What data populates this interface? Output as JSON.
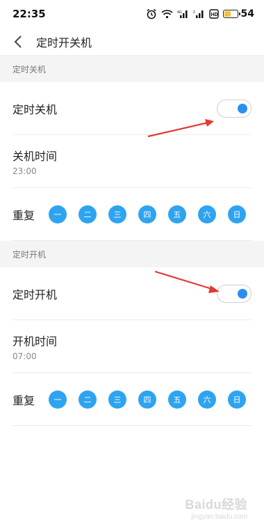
{
  "status_bar": {
    "time": "22:35",
    "battery_percent": "54",
    "battery_level": 0.54
  },
  "header": {
    "title": "定时开关机"
  },
  "shutdown": {
    "section_title": "定时关机",
    "toggle_label": "定时关机",
    "toggle_on": true,
    "time_label": "关机时间",
    "time_value": "23:00",
    "repeat_label": "重复",
    "days": [
      "一",
      "二",
      "三",
      "四",
      "五",
      "六",
      "日"
    ]
  },
  "startup": {
    "section_title": "定时开机",
    "toggle_label": "定时开机",
    "toggle_on": true,
    "time_label": "开机时间",
    "time_value": "07:00",
    "repeat_label": "重复",
    "days": [
      "一",
      "二",
      "三",
      "四",
      "五",
      "六",
      "日"
    ]
  },
  "colors": {
    "accent": "#2b8ff0",
    "day_bg": "#2ea4f0",
    "arrow": "#e53935"
  },
  "watermark": {
    "logo": "Baidu经验",
    "url": "jingyan.baidu.com"
  }
}
